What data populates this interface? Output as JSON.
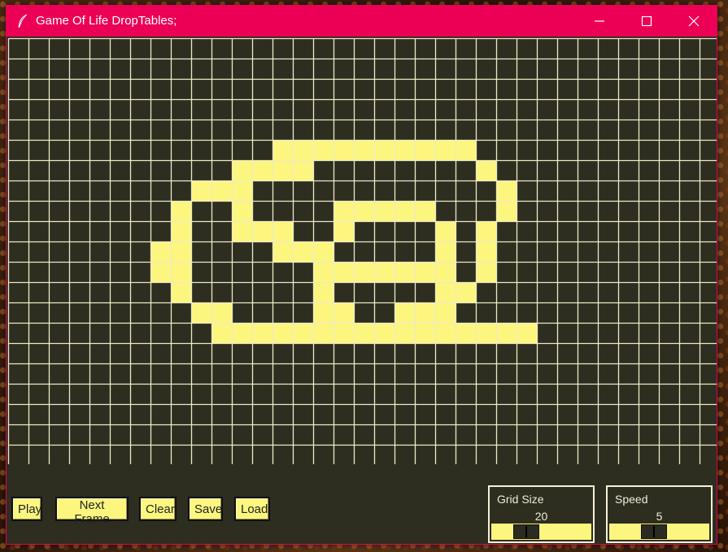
{
  "window": {
    "title": "Game Of Life DropTables;",
    "app_icon": "feather-icon",
    "controls": [
      "minimize-icon",
      "maximize-icon",
      "close-icon"
    ]
  },
  "colors": {
    "titlebar": "#ec0055",
    "background": "#2d2d20",
    "grid_line": "#efeac6",
    "cell_alive": "#fcf67f",
    "button_bg": "#fcf67f",
    "label_text": "#f0ecd8"
  },
  "grid": {
    "rows": 21,
    "cols": 35,
    "alive_cells": [
      [
        5,
        13
      ],
      [
        5,
        14
      ],
      [
        5,
        15
      ],
      [
        5,
        16
      ],
      [
        5,
        17
      ],
      [
        5,
        18
      ],
      [
        5,
        19
      ],
      [
        5,
        20
      ],
      [
        5,
        21
      ],
      [
        5,
        22
      ],
      [
        6,
        11
      ],
      [
        6,
        12
      ],
      [
        6,
        13
      ],
      [
        6,
        14
      ],
      [
        6,
        23
      ],
      [
        7,
        9
      ],
      [
        7,
        10
      ],
      [
        7,
        11
      ],
      [
        7,
        24
      ],
      [
        8,
        8
      ],
      [
        8,
        11
      ],
      [
        8,
        16
      ],
      [
        8,
        17
      ],
      [
        8,
        18
      ],
      [
        8,
        19
      ],
      [
        8,
        20
      ],
      [
        8,
        24
      ],
      [
        9,
        8
      ],
      [
        9,
        11
      ],
      [
        9,
        12
      ],
      [
        9,
        13
      ],
      [
        9,
        16
      ],
      [
        9,
        21
      ],
      [
        9,
        23
      ],
      [
        10,
        7
      ],
      [
        10,
        8
      ],
      [
        10,
        13
      ],
      [
        10,
        14
      ],
      [
        10,
        15
      ],
      [
        10,
        21
      ],
      [
        10,
        23
      ],
      [
        11,
        7
      ],
      [
        11,
        8
      ],
      [
        11,
        15
      ],
      [
        11,
        16
      ],
      [
        11,
        17
      ],
      [
        11,
        18
      ],
      [
        11,
        19
      ],
      [
        11,
        20
      ],
      [
        11,
        21
      ],
      [
        11,
        23
      ],
      [
        12,
        8
      ],
      [
        12,
        15
      ],
      [
        12,
        21
      ],
      [
        12,
        22
      ],
      [
        13,
        9
      ],
      [
        13,
        10
      ],
      [
        13,
        15
      ],
      [
        13,
        16
      ],
      [
        13,
        19
      ],
      [
        13,
        20
      ],
      [
        13,
        21
      ],
      [
        14,
        10
      ],
      [
        14,
        11
      ],
      [
        14,
        12
      ],
      [
        14,
        13
      ],
      [
        14,
        14
      ],
      [
        14,
        15
      ],
      [
        14,
        16
      ],
      [
        14,
        17
      ],
      [
        14,
        18
      ],
      [
        14,
        19
      ],
      [
        14,
        20
      ],
      [
        14,
        21
      ],
      [
        14,
        22
      ],
      [
        14,
        23
      ],
      [
        14,
        24
      ],
      [
        14,
        25
      ]
    ]
  },
  "controls": {
    "play_label": "Play",
    "next_frame_label": "Next Frame",
    "clear_label": "Clear",
    "save_label": "Save",
    "load_label": "Load",
    "grid_size": {
      "label": "Grid Size",
      "value": "20",
      "level": 0.35
    },
    "speed": {
      "label": "Speed",
      "value": "5",
      "level": 0.45
    }
  }
}
